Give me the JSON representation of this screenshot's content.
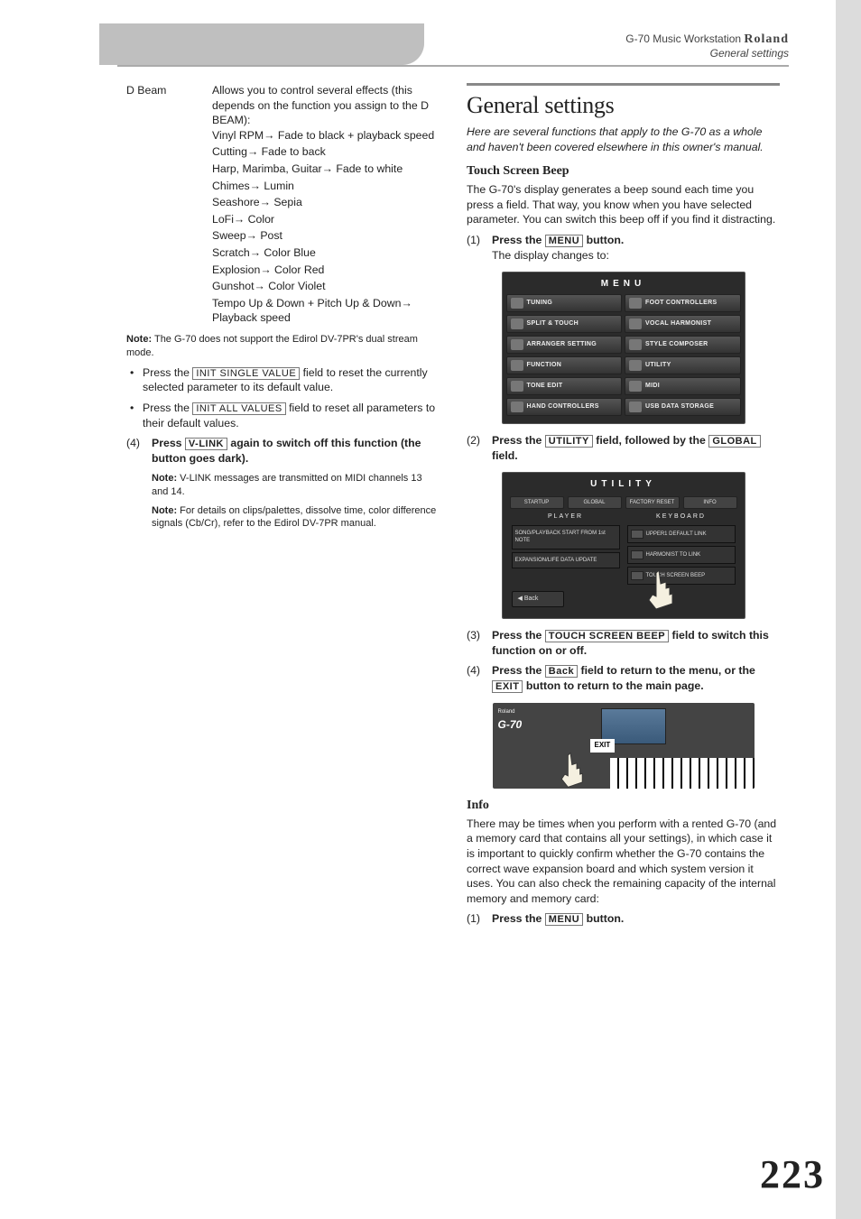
{
  "header": {
    "product": "G-70 Music Workstation",
    "brand": "Roland",
    "section": "General settings"
  },
  "left": {
    "dbeam_label": "D Beam",
    "dbeam_intro": "Allows you to control several effects (this depends on the function you assign to the D BEAM):",
    "mappings": [
      {
        "src": "Vinyl RPM",
        "dst": "Fade to black + playback speed"
      },
      {
        "src": "Cutting",
        "dst": "Fade to back"
      },
      {
        "src": "Harp, Marimba, Guitar",
        "dst": "Fade to white"
      },
      {
        "src": "Chimes",
        "dst": "Lumin"
      },
      {
        "src": "Seashore",
        "dst": "Sepia"
      },
      {
        "src": "LoFi",
        "dst": "Color"
      },
      {
        "src": "Sweep",
        "dst": "Post"
      },
      {
        "src": "Scratch",
        "dst": "Color Blue"
      },
      {
        "src": "Explosion",
        "dst": "Color Red"
      },
      {
        "src": "Gunshot",
        "dst": "Color Violet"
      },
      {
        "src": "Tempo Up & Down + Pitch Up & Down",
        "dst": "Playback speed"
      }
    ],
    "note1_label": "Note:",
    "note1": "The G-70 does not support the Edirol DV-7PR's dual stream mode.",
    "bullet1a": "Press the ",
    "bullet1_field": "INIT SINGLE VALUE",
    "bullet1b": " field to reset the currently selected parameter to its default value.",
    "bullet2a": "Press the ",
    "bullet2_field": "INIT ALL VALUES",
    "bullet2b": " field to reset all parameters to their default values.",
    "step4_num": "(4)",
    "step4a": "Press ",
    "step4_field": "V-LINK",
    "step4b": " again to switch off this function (the button goes dark).",
    "note2_label": "Note:",
    "note2": "V-LINK messages are transmitted on MIDI channels 13 and 14.",
    "note3_label": "Note:",
    "note3": "For details on clips/palettes, dissolve time, color difference signals (Cb/Cr), refer to the Edirol DV-7PR manual."
  },
  "right": {
    "h1": "General settings",
    "lede": "Here are several functions that apply to the G-70 as a whole and haven't been covered elsewhere in this owner's manual.",
    "touch_h2": "Touch Screen Beep",
    "touch_p": "The G-70's display generates a beep sound each time you press a field. That way, you know when you have selected parameter. You can switch this beep off if you find it distracting.",
    "s1_num": "(1)",
    "s1a": "Press the ",
    "s1_field": "MENU",
    "s1b": " button.",
    "s1_sub": "The display changes to:",
    "menu_title": "MENU",
    "menu_items": [
      "TUNING",
      "FOOT CONTROLLERS",
      "SPLIT & TOUCH",
      "VOCAL HARMONIST",
      "ARRANGER SETTING",
      "STYLE COMPOSER",
      "FUNCTION",
      "UTILITY",
      "TONE EDIT",
      "MIDI",
      "HAND CONTROLLERS",
      "USB DATA STORAGE"
    ],
    "s2_num": "(2)",
    "s2a": "Press the ",
    "s2_field1": "UTILITY",
    "s2b": " field, followed by the ",
    "s2_field2": "GLOBAL",
    "s2c": " field.",
    "util_title": "UTILITY",
    "util_tabs": [
      "STARTUP",
      "GLOBAL",
      "FACTORY RESET",
      "INFO"
    ],
    "util_left_head": "PLAYER",
    "util_left_items": [
      "SONG/PLAYBACK START FROM 1st NOTE",
      "EXPANSION/LIFE DATA UPDATE"
    ],
    "util_right_head": "KEYBOARD",
    "util_right_items": [
      "UPPER1 DEFAULT LINK",
      "HARMONIST TO LINK",
      "TOUCH SCREEN BEEP"
    ],
    "util_back": "Back",
    "s3_num": "(3)",
    "s3a": "Press the ",
    "s3_field": "TOUCH SCREEN BEEP",
    "s3b": " field to switch this function on or off.",
    "s4_num": "(4)",
    "s4a": "Press the ",
    "s4_field1": "Back",
    "s4b": " field to return to the menu, or the ",
    "s4_field2": "EXIT",
    "s4c": " button to return to the main page.",
    "panel_brand": "Roland",
    "panel_model": "G-70",
    "panel_exit": "EXIT",
    "info_h2": "Info",
    "info_p": "There may be times when you perform with a rented G-70 (and a memory card that contains all your settings), in which case it is important to quickly confirm whether the G-70 contains the correct wave expansion board and which system version it uses. You can also check the remaining capacity of the internal memory and memory card:",
    "info_s1_num": "(1)",
    "info_s1a": "Press the ",
    "info_s1_field": "MENU",
    "info_s1b": " button."
  },
  "page_number": "223"
}
